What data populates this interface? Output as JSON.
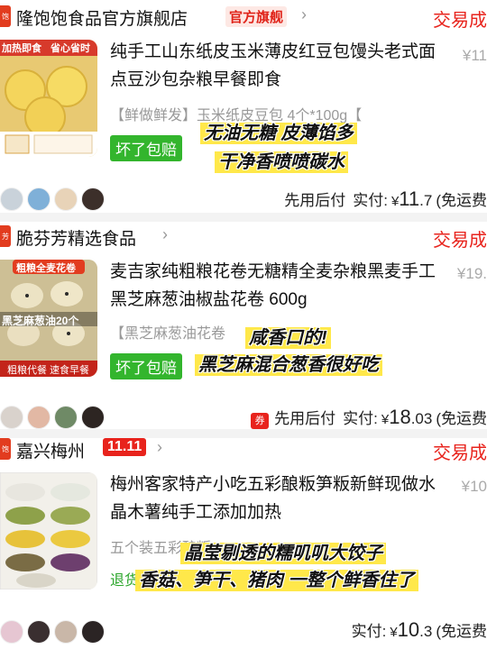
{
  "orders": [
    {
      "shop": {
        "logo": "饱",
        "name": "隆饱饱食品官方旗舰店",
        "tag": "官方旗舰",
        "status": "交易成"
      },
      "thumb_labels": {
        "top": "加热即食",
        "top2": "省心省时"
      },
      "title": "纯手工山东纸皮玉米薄皮红豆包馒头老式面点豆沙包杂粮早餐即食",
      "orig_price": "¥11",
      "spec": "【鲜做鲜发】玉米纸皮豆包 4个*100g【",
      "badge": "坏了包赔",
      "pay": {
        "label": "先用后付",
        "paid_label": "实付:",
        "currency": "¥",
        "int": "11",
        "dec": ".7",
        "extra": "(免运费"
      },
      "caption_lines": [
        "无油无糖 皮薄馅多",
        "干净香喷喷碳水"
      ]
    },
    {
      "shop": {
        "logo": "芳",
        "name": "脆芬芳精选食品",
        "status": "交易成"
      },
      "thumb_labels": {
        "top": "粗粮全麦花卷",
        "mid": "黑芝麻葱油20个",
        "bottom": "粗粮代餐 速食早餐"
      },
      "title": "麦吉家纯粗粮花卷无糖精全麦杂粮黑麦手工黑芝麻葱油椒盐花卷 600g",
      "orig_price": "¥19.",
      "spec": "【黑芝麻葱油花卷",
      "badge": "坏了包赔",
      "pay": {
        "coupon": "券",
        "label": "先用后付",
        "paid_label": "实付:",
        "currency": "¥",
        "int": "18",
        "dec": ".03",
        "extra": "(免运费"
      },
      "caption_lines": [
        "咸香口的!",
        "黑芝麻混合葱香很好吃"
      ]
    },
    {
      "shop": {
        "logo": "饱",
        "name": "嘉兴梅州",
        "tag": "11.11",
        "status": "交易成"
      },
      "title": "梅州客家特产小吃五彩酿粄笋粄新鲜现做水晶木薯纯手工添加加热",
      "orig_price": "¥10",
      "spec": "五个装五彩酿粄",
      "refund": "退货",
      "pay": {
        "paid_label": "实付:",
        "currency": "¥",
        "int": "10",
        "dec": ".3",
        "extra": "(免运费"
      },
      "caption_lines": [
        "晶莹剔透的糯叽叽大饺子",
        "香菇、笋干、猪肉 一整个鲜香住了"
      ]
    }
  ],
  "colors": {
    "accent": "#e8231c",
    "badge_green": "#33b52d",
    "caption_bg": "#ffe84a"
  }
}
